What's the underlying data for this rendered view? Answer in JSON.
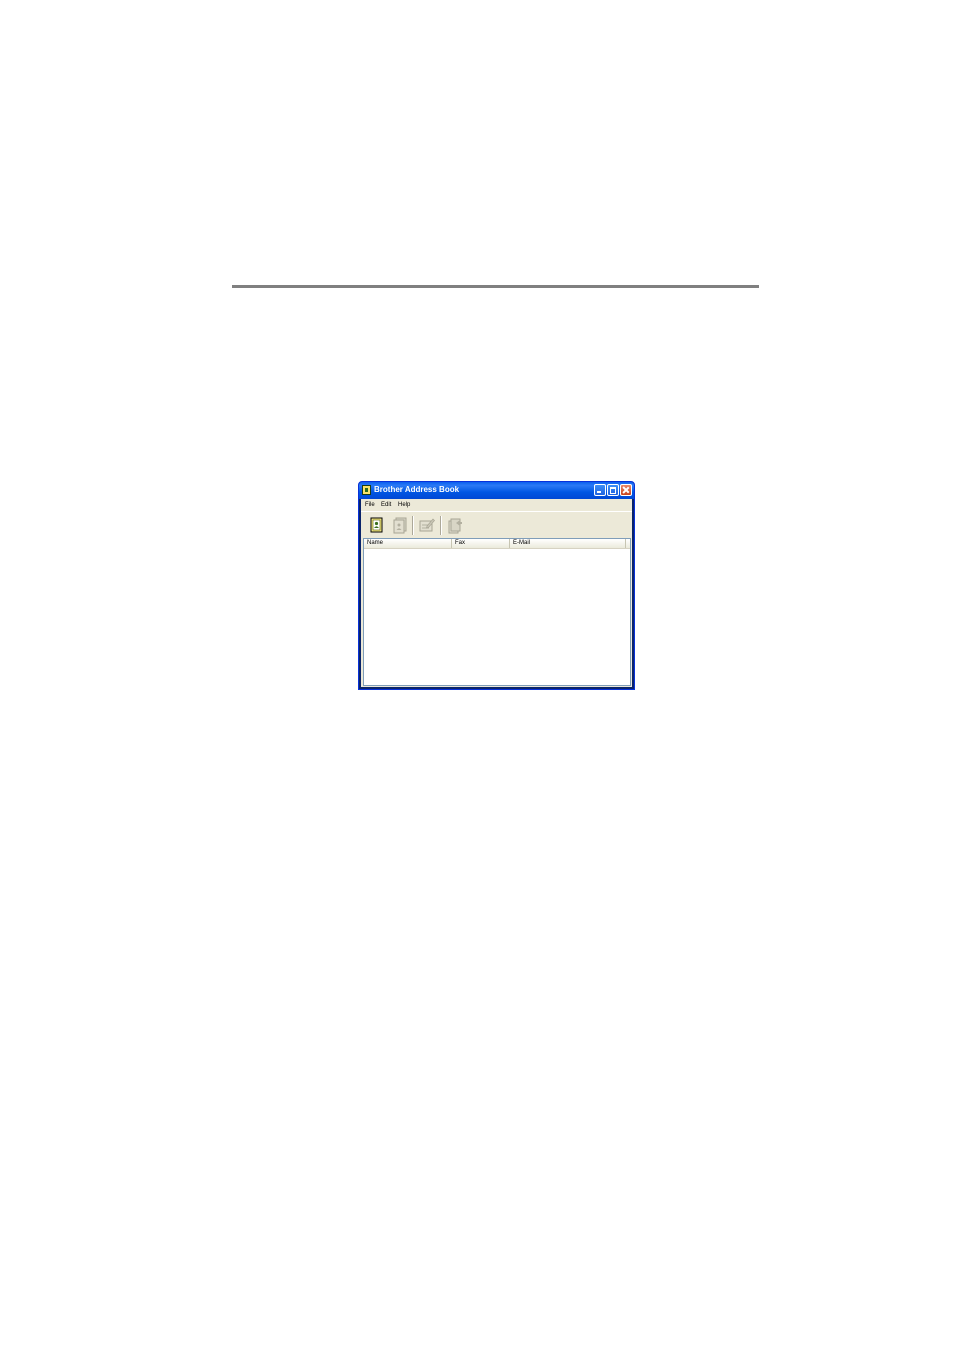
{
  "window": {
    "title": "Brother Address Book"
  },
  "menubar": {
    "items": [
      {
        "label": "File"
      },
      {
        "label": "Edit"
      },
      {
        "label": "Help"
      }
    ]
  },
  "toolbar": {
    "buttons": [
      {
        "icon": "new-contact-icon",
        "enabled": true
      },
      {
        "icon": "new-group-icon",
        "enabled": false
      },
      {
        "icon": "edit-icon",
        "enabled": false
      },
      {
        "icon": "delete-icon",
        "enabled": false
      }
    ]
  },
  "list": {
    "columns": [
      {
        "label": "Name"
      },
      {
        "label": "Fax"
      },
      {
        "label": "E-Mail"
      }
    ],
    "rows": []
  }
}
